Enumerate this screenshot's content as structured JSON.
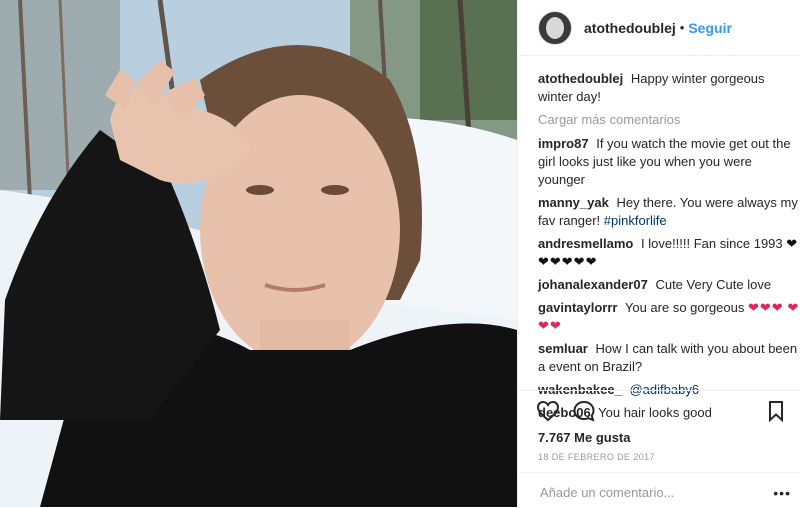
{
  "header": {
    "username": "atothedoublej",
    "separator": "•",
    "follow_label": "Seguir"
  },
  "caption": {
    "username": "atothedoublej",
    "text": "Happy winter gorgeous winter day!"
  },
  "load_more_label": "Cargar más comentarios",
  "comments": [
    {
      "user": "impro87",
      "text": "If you watch the movie get out the girl looks just like you when you were younger"
    },
    {
      "user": "manny_yak",
      "text": "Hey there. You were always my fav ranger!",
      "tag": "#pinkforlife"
    },
    {
      "user": "andresmellamo",
      "text": "I love!!!!! Fan since 1993",
      "emoji": "❤",
      "emoji2": "❤❤❤❤❤"
    },
    {
      "user": "johanalexander07",
      "text": "Cute Very Cute love"
    },
    {
      "user": "gavintaylorrr",
      "text": "You are so gorgeous",
      "emoji": "❤❤❤",
      "emoji2": "❤❤❤"
    },
    {
      "user": "semluar",
      "text": "How I can talk with you about been a event on Brazil?"
    },
    {
      "user": "wakenbakee_",
      "tag": "@adifbaby6"
    },
    {
      "user": "deebo06",
      "text": "You hair looks good"
    }
  ],
  "icons": {
    "like": "heart-icon",
    "comment": "comment-icon",
    "save": "bookmark-icon",
    "more": "more-options-icon"
  },
  "likes_label": "7.767 Me gusta",
  "date_label": "18 DE FEBRERO DE 2017",
  "add_comment": {
    "placeholder": "Añade un comentario...",
    "more_icon_text": "•••"
  },
  "colors": {
    "link": "#3897f0",
    "heart": "#e0245e",
    "muted": "#999999"
  }
}
